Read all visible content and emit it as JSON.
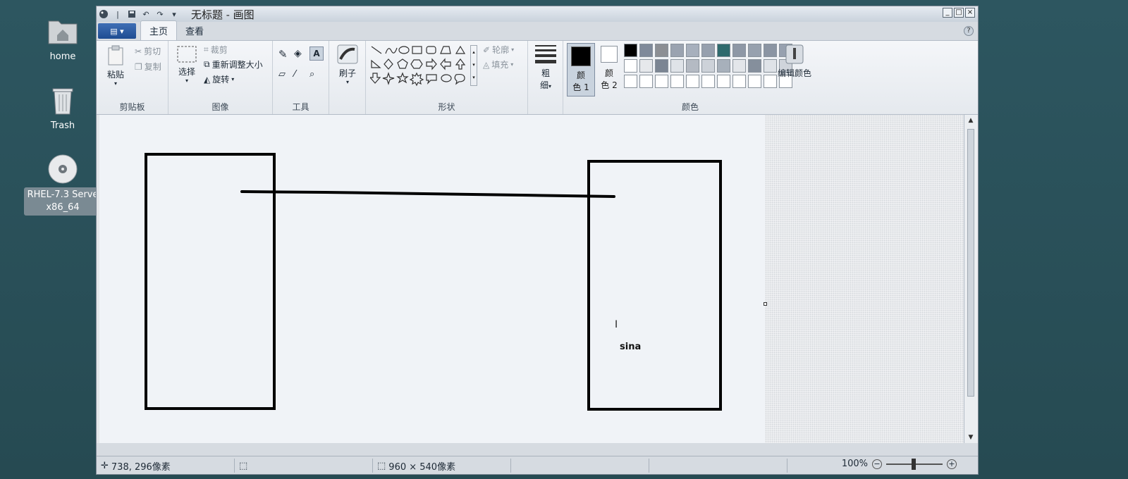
{
  "desktop": {
    "icons": [
      {
        "label": "home",
        "icon": "folder-home-icon"
      },
      {
        "label": "Trash",
        "icon": "trash-icon"
      },
      {
        "label_line1": "RHEL-7.3 Serve",
        "label_line2": "x86_64",
        "icon": "disc-icon"
      }
    ]
  },
  "window": {
    "title": "无标题 - 画图",
    "controls": {
      "minimize": "_",
      "maximize": "□",
      "close": "×"
    }
  },
  "tabs": {
    "menu_button": "▤ ▾",
    "home": "主页",
    "view": "查看"
  },
  "ribbon": {
    "clipboard": {
      "label": "剪贴板",
      "paste": "粘贴",
      "cut": "剪切",
      "copy": "复制"
    },
    "image": {
      "label": "图像",
      "select": "选择",
      "crop": "裁剪",
      "resize": "重新调整大小",
      "rotate": "旋转"
    },
    "tools": {
      "label": "工具"
    },
    "brushes": {
      "label": "刷子"
    },
    "shapes": {
      "label": "形状",
      "outline": "轮廓",
      "fill": "填充"
    },
    "size": {
      "line1": "粗",
      "line2": "细"
    },
    "colors": {
      "label": "颜色",
      "color1_line1": "颜",
      "color1_line2": "色 1",
      "color2_line1": "颜",
      "color2_line2": "色 2",
      "edit": "编辑颜色",
      "palette_row1": [
        "#000000",
        "#7f8a9a",
        "#8c8f94",
        "#9aa3b0",
        "#a7b0bd",
        "#96a0ae",
        "#2f6a6d",
        "#8e98a6",
        "#97a1ae",
        "#8b95a3",
        "#97a1af"
      ],
      "palette_row2": [
        "#ffffff",
        "#e6e8eb",
        "#7b8593",
        "#dfe3e8",
        "#b4bac3",
        "#cdd2d9",
        "#a7b0bb",
        "#e3e6ea",
        "#858f9c",
        "#dfe3e8",
        "#cfd4db"
      ]
    }
  },
  "canvas": {
    "text": "sina",
    "ibeam": "I"
  },
  "status": {
    "cursor_pos": "738, 296像素",
    "image_size": "960 × 540像素",
    "zoom": "100%",
    "zoom_minus": "−",
    "zoom_plus": "+"
  }
}
